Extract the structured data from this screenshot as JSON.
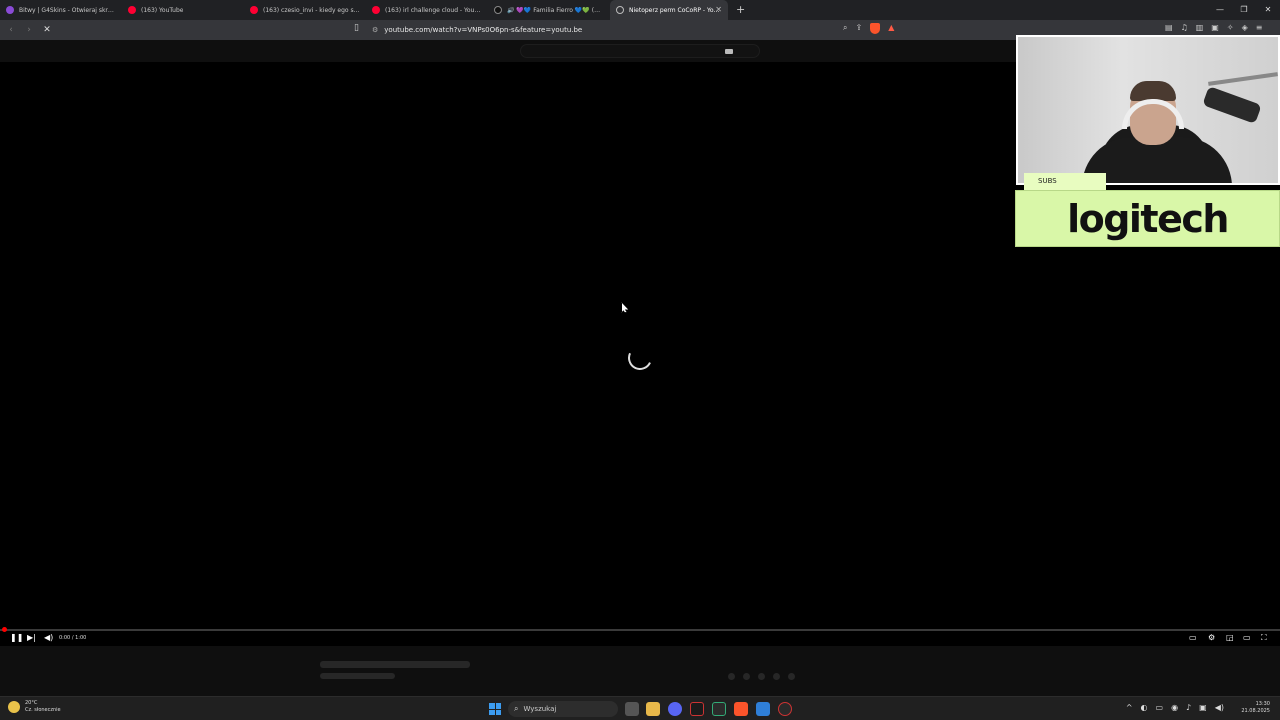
{
  "browser": {
    "tabs": [
      {
        "label": "Bitwy | G4Skins - Otwieraj skrzynki CS",
        "color": "#8a4bd6"
      },
      {
        "label": "(163) YouTube",
        "color": "#ff0033"
      },
      {
        "label": "(163) czesio_invi - kiedy ego szerza",
        "color": "#ff0033"
      },
      {
        "label": "(163) irl challenge cloud - YouTube",
        "color": "#ff0033"
      },
      {
        "label": "🔊 💜💙 Familia Fierro 💙💚 (@fa",
        "color": "#111111"
      },
      {
        "label": "Nietoperz perm CoCoRP - YouTu",
        "color": "#bbbbbb",
        "active": true
      }
    ],
    "newtab": "+",
    "url": "youtube.com/watch?v=VNPs0O6pn-s&feature=youtu.be",
    "shield_count": "0"
  },
  "player": {
    "time": "0:00 / 1:00"
  },
  "overlay": {
    "subs_label": "SUBS",
    "sponsor": "logitech"
  },
  "taskbar": {
    "weather_temp": "20°C",
    "weather_desc": "Cz. słonecznie",
    "search_placeholder": "Wyszukaj",
    "time": "13:30",
    "date": "21.08.2025"
  }
}
